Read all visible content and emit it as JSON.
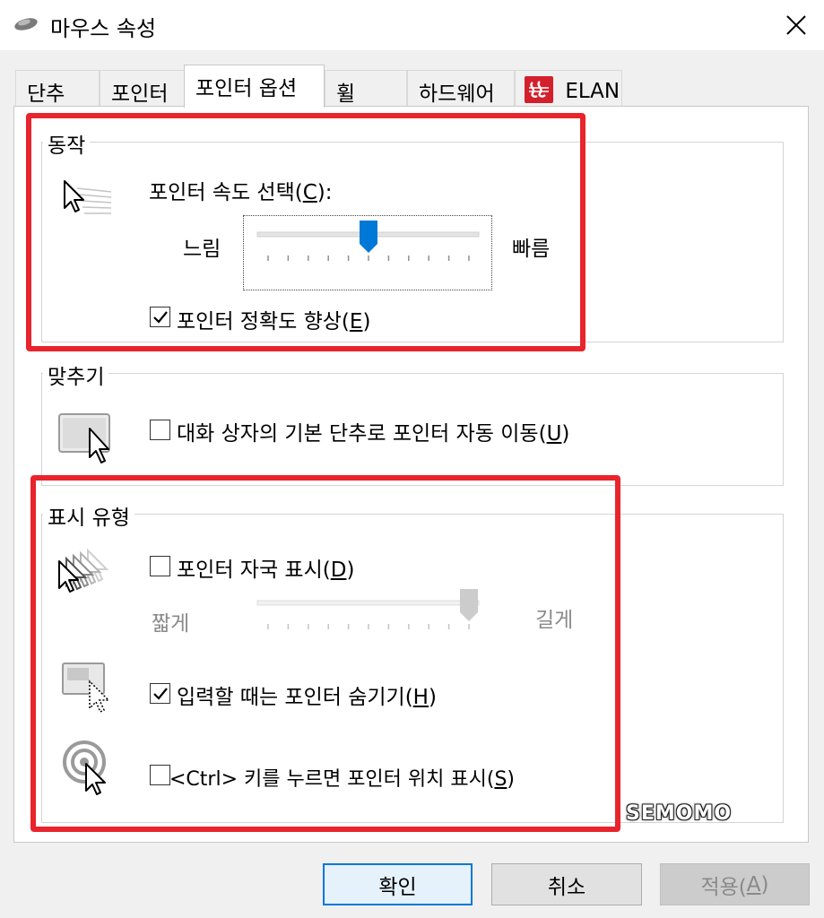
{
  "window": {
    "title": "마우스 속성"
  },
  "tabs": [
    {
      "label": "단추"
    },
    {
      "label": "포인터"
    },
    {
      "label": "포인터 옵션"
    },
    {
      "label": "휠"
    },
    {
      "label": "하드웨어"
    },
    {
      "label": "ELAN"
    }
  ],
  "motion": {
    "legend": "동작",
    "speed_label": "포인터 속도 선택(",
    "speed_key": "C",
    "speed_suffix": "):",
    "slow": "느림",
    "fast": "빠름",
    "speed_level": 0.5,
    "precision_label": "포인터 정확도 향상(",
    "precision_key": "E",
    "precision_suffix": ")",
    "precision_checked": true
  },
  "snap": {
    "legend": "맞추기",
    "label": "대화 상자의 기본 단추로 포인터 자동 이동(",
    "key": "U",
    "suffix": ")",
    "checked": false
  },
  "visibility": {
    "legend": "표시 유형",
    "trails_label": "포인터 자국 표시(",
    "trails_key": "D",
    "trails_suffix": ")",
    "trails_checked": false,
    "short": "짧게",
    "long": "길게",
    "trail_level": 1.0,
    "hide_label": "입력할 때는 포인터 숨기기(",
    "hide_key": "H",
    "hide_suffix": ")",
    "hide_checked": true,
    "ctrl_label": "<Ctrl> 키를 누르면 포인터 위치 표시(",
    "ctrl_key": "S",
    "ctrl_suffix": ")",
    "ctrl_checked": false
  },
  "buttons": {
    "ok": "확인",
    "cancel": "취소",
    "apply_label": "적용(",
    "apply_key": "A",
    "apply_suffix": ")"
  },
  "watermark": "SEMOMO",
  "colors": {
    "highlight": "#e8242c",
    "accent": "#0078d7",
    "elan_logo": "#d3202c"
  }
}
